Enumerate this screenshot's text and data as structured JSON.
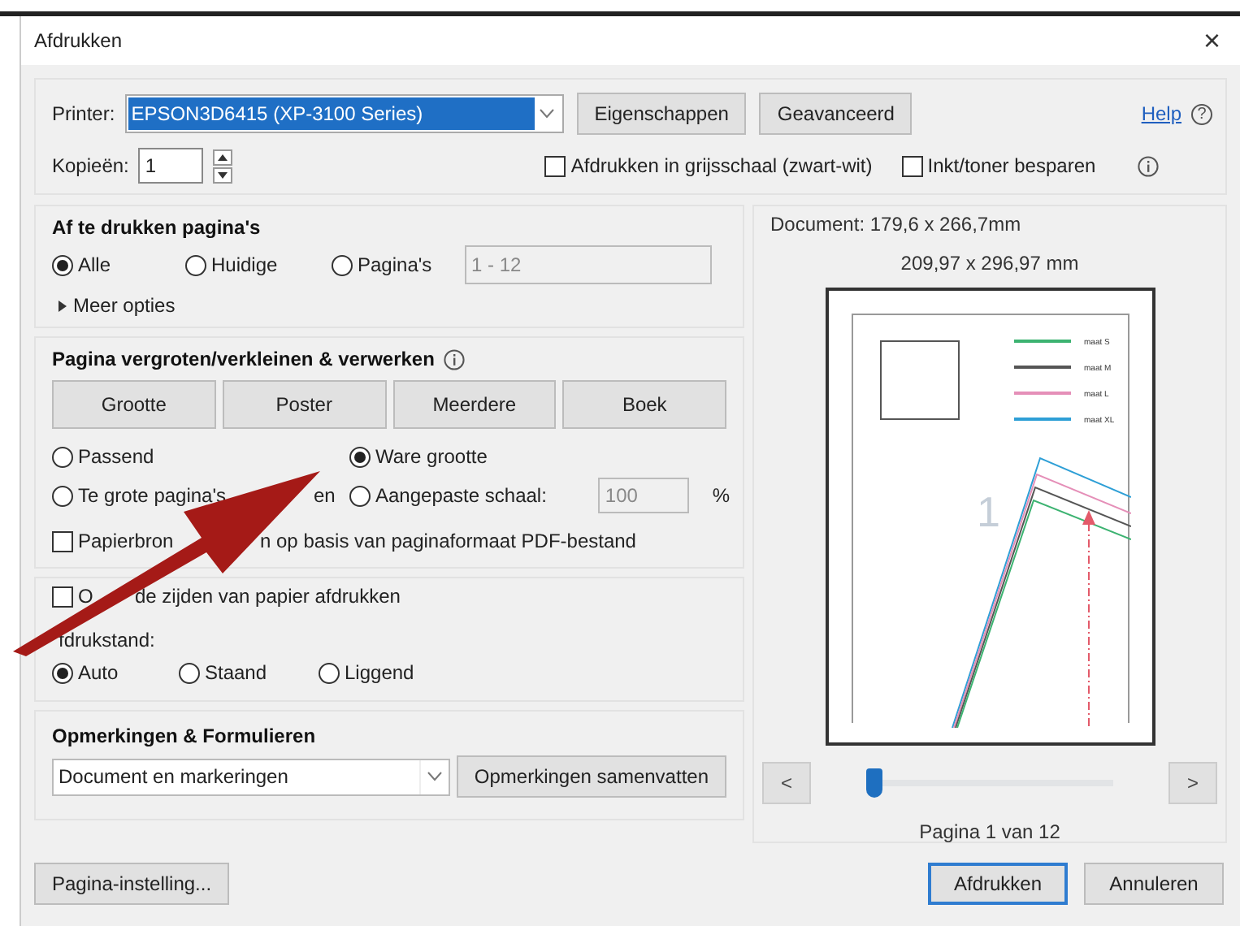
{
  "window": {
    "title": "Afdrukken",
    "close": "×"
  },
  "printer": {
    "label": "Printer:",
    "value": "EPSON3D6415 (XP-3100 Series)",
    "buttons": [
      "Eigenschappen",
      "Geavanceerd"
    ]
  },
  "help": {
    "label": "Help",
    "icon": "?"
  },
  "copies": {
    "label": "Kopieën:",
    "value": "1"
  },
  "options": [
    {
      "label": "Afdrukken in grijsschaal (zwart-wit)",
      "checked": false
    },
    {
      "label": "Inkt/toner besparen",
      "checked": false
    }
  ],
  "pages_section": {
    "title": "Af te drukken pagina's",
    "radios": [
      {
        "label": "Alle",
        "selected": true
      },
      {
        "label": "Huidige",
        "selected": false
      },
      {
        "label": "Pagina's",
        "selected": false
      }
    ],
    "range": {
      "value": "1 - 12",
      "disabled": true
    },
    "more": "Meer opties"
  },
  "scaling_section": {
    "title": "Pagina vergroten/verkleinen & verwerken",
    "buttons": [
      "Grootte",
      "Poster",
      "Meerdere",
      "Boek"
    ],
    "radios": [
      {
        "label": "Passend",
        "selected": false
      },
      {
        "label": "Ware grootte",
        "selected": true
      },
      {
        "label_parts": [
          "Te grote pagina's",
          "en"
        ],
        "selected": false
      },
      {
        "label": "Aangepaste schaal:",
        "selected": false
      }
    ],
    "scale": {
      "value": "100",
      "disabled": true,
      "unit": "%"
    },
    "paper_source": {
      "label_parts": [
        "Papierbron",
        "n op basis van paginaformaat PDF-bestand"
      ],
      "checked": false
    }
  },
  "duplex": {
    "label_parts": [
      "O",
      "de zijden van papier afdrukken"
    ],
    "checked": false
  },
  "orientation": {
    "label": "fdrukstand:",
    "radios": [
      {
        "label": "Auto",
        "selected": true
      },
      {
        "label": "Staand",
        "selected": false
      },
      {
        "label": "Liggend",
        "selected": false
      }
    ]
  },
  "comments": {
    "title": "Opmerkingen & Formulieren",
    "dropdown": "Document en markeringen",
    "button": "Opmerkingen samenvatten"
  },
  "preview": {
    "document_size": "Document: 179,6 x 266,7mm",
    "paper_size": "209,97 x 296,97 mm",
    "page_number": "1",
    "legend": [
      {
        "label": "maat S",
        "color": "#3cb371"
      },
      {
        "label": "maat M",
        "color": "#555555"
      },
      {
        "label": "maat L",
        "color": "#e58fb8"
      },
      {
        "label": "maat XL",
        "color": "#2e9fd6"
      }
    ],
    "prev": "<",
    "next": ">",
    "slider": {
      "level": 0.0
    },
    "page_label": "Pagina 1 van 12"
  },
  "footer": {
    "setup_button": "Pagina-instelling...",
    "print_button": "Afdrukken",
    "cancel_button": "Annuleren"
  }
}
